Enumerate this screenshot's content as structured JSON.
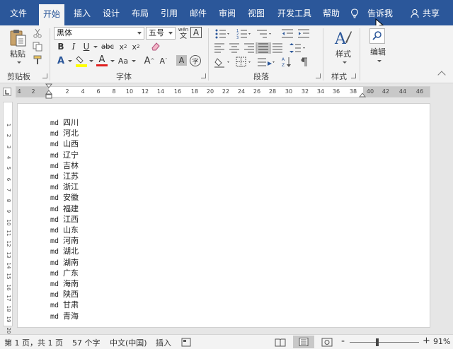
{
  "tabs": [
    "文件",
    "开始",
    "插入",
    "设计",
    "布局",
    "引用",
    "邮件",
    "审阅",
    "视图",
    "开发工具",
    "帮助"
  ],
  "tell_me": "告诉我",
  "share": "共享",
  "clipboard": {
    "paste": "粘贴",
    "label": "剪贴板"
  },
  "font": {
    "name": "黑体",
    "size": "五号",
    "label": "字体",
    "wen": "wén",
    "wen_char": "文",
    "abc": "abc",
    "aa": "Aa",
    "A": "A",
    "zi": "字"
  },
  "paragraph": {
    "label": "段落"
  },
  "styles": {
    "btn": "样式",
    "label": "样式"
  },
  "editing": {
    "btn": "编辑"
  },
  "ruler": {
    "numbers": [
      "4",
      "2",
      "2",
      "4",
      "6",
      "8",
      "10",
      "12",
      "14",
      "16",
      "18",
      "20",
      "22",
      "24",
      "26",
      "28",
      "30",
      "32",
      "34",
      "36",
      "38",
      "40",
      "42",
      "44",
      "46"
    ]
  },
  "vruler": {
    "numbers": [
      "1",
      "2",
      "3",
      "4",
      "5",
      "6",
      "7",
      "8",
      "9",
      "10",
      "11",
      "12",
      "13",
      "14",
      "15",
      "16",
      "17",
      "18",
      "19",
      "20"
    ]
  },
  "document": {
    "prefix": "md",
    "lines": [
      "四川",
      "河北",
      "山西",
      "辽宁",
      "吉林",
      "江苏",
      "浙江",
      "安徽",
      "福建",
      "江西",
      "山东",
      "河南",
      "湖北",
      "湖南",
      "广东",
      "海南",
      "陕西",
      "甘肃",
      "青海"
    ]
  },
  "status": {
    "page": "第 1 页，共 1 页",
    "words": "57 个字",
    "language": "中文(中国)",
    "mode": "插入",
    "zoom": "91%",
    "minus": "-",
    "plus": "+"
  },
  "colors": {
    "accent": "#2b579a",
    "highlight": "#ffff00",
    "font_color": "#e02020"
  }
}
